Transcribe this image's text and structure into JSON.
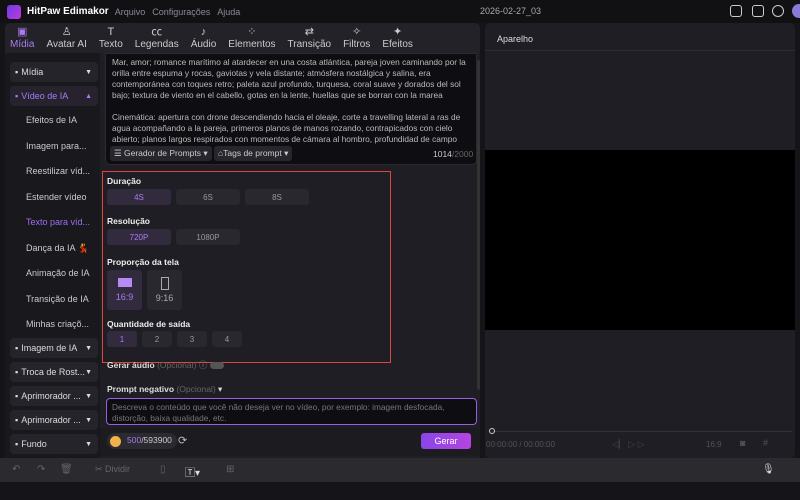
{
  "app": {
    "name": "HitPaw Edimakor",
    "menu": [
      "Arquivo",
      "Configurações",
      "Ajuda"
    ],
    "project": "2026-02-27_03"
  },
  "tabs": [
    {
      "label": "Mídia",
      "icon": "▣"
    },
    {
      "label": "Avatar AI",
      "icon": "♙"
    },
    {
      "label": "Texto",
      "icon": "T"
    },
    {
      "label": "Legendas",
      "icon": "㏄"
    },
    {
      "label": "Áudio",
      "icon": "♪"
    },
    {
      "label": "Elementos",
      "icon": "⁘"
    },
    {
      "label": "Transição",
      "icon": "⇄"
    },
    {
      "label": "Filtros",
      "icon": "✧"
    },
    {
      "label": "Efeitos",
      "icon": "✦"
    }
  ],
  "sidebar": {
    "groups": [
      {
        "label": "Mídia"
      },
      {
        "label": "Vídeo de IA"
      },
      {
        "label": "Imagem de IA"
      },
      {
        "label": "Troca de Rost..."
      },
      {
        "label": "Aprimorador ..."
      },
      {
        "label": "Aprimorador ..."
      },
      {
        "label": "Fundo"
      }
    ],
    "items": [
      "Efeitos de IA",
      "Imagem para...",
      "Reestilizar víd...",
      "Estender vídeo",
      "Texto para víd...",
      "Dança da IA 💃",
      "Animação de IA",
      "Transição de IA",
      "Minhas criaçõ..."
    ]
  },
  "prompt": {
    "p1": "Mar, amor; romance marítimo al atardecer en una costa atlántica, pareja joven caminando por la orilla entre espuma y rocas, gaviotas y vela distante; atmósfera nostálgica y salina, era contemporánea con toques retro; paleta azul profundo, turquesa, coral suave y dorados del sol bajo; textura de viento en el cabello, gotas en la lente, huellas que se borran con la marea",
    "p2": "Cinemática: apertura con drone descendiendo hacia el oleaje, corte a travelling lateral a ras de agua acompañando a la pareja, primeros planos de manos rozando, contrapicados con cielo abierto; planos largos respirados con momentos de cámara al hombro, profundidad de campo",
    "generator": "Gerador de Prompts",
    "tags": "Tags de prompt",
    "count": "1014",
    "max": "/2000"
  },
  "duration": {
    "label": "Duração",
    "options": [
      "4S",
      "6S",
      "8S"
    ],
    "selected": "4S"
  },
  "resolution": {
    "label": "Resolução",
    "options": [
      "720P",
      "1080P"
    ],
    "selected": "720P"
  },
  "ratio": {
    "label": "Proporção da tela",
    "options": [
      "16:9",
      "9:16"
    ],
    "selected": "16:9"
  },
  "quantity": {
    "label": "Quantidade de saída",
    "options": [
      "1",
      "2",
      "3",
      "4"
    ],
    "selected": "1"
  },
  "audio": {
    "label": "Gerar áudio",
    "optional": "(Opcional)",
    "enabled": false
  },
  "negative": {
    "label": "Prompt negativo",
    "optional": "(Opcional)",
    "placeholder": "Descreva o conteúdo que você não deseja ver no vídeo, por exemplo: imagem desfocada, distorção, baixa qualidade, etc."
  },
  "credits": {
    "cost": "500",
    "total": "/593900"
  },
  "generate": "Gerar",
  "preview": {
    "title": "Aparelho",
    "time": "00:00:00 / 00:00:00",
    "ratio": "16:9"
  },
  "timeline": {
    "split": "Dividir"
  },
  "colors": {
    "accent": "#a97bf0",
    "highlight": "#e0443a"
  }
}
